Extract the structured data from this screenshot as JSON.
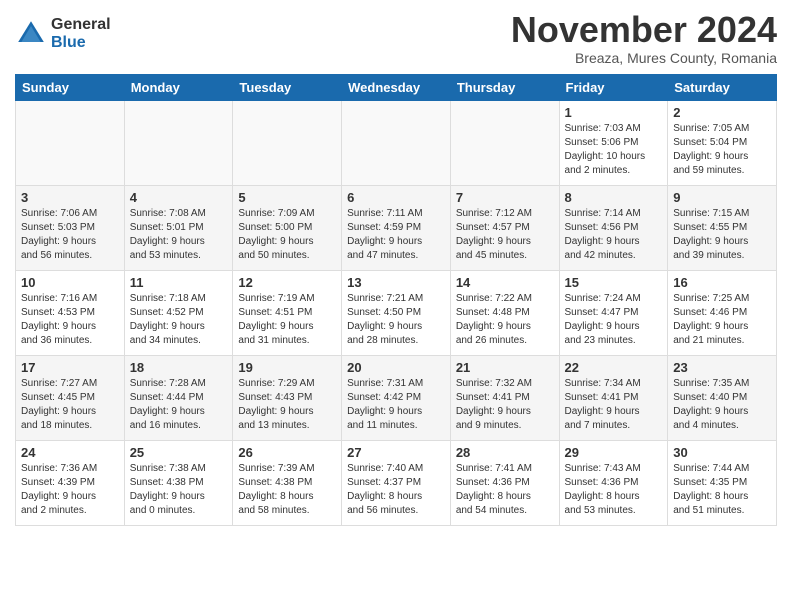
{
  "logo": {
    "general": "General",
    "blue": "Blue"
  },
  "title": "November 2024",
  "subtitle": "Breaza, Mures County, Romania",
  "days_header": [
    "Sunday",
    "Monday",
    "Tuesday",
    "Wednesday",
    "Thursday",
    "Friday",
    "Saturday"
  ],
  "weeks": [
    [
      {
        "day": "",
        "info": ""
      },
      {
        "day": "",
        "info": ""
      },
      {
        "day": "",
        "info": ""
      },
      {
        "day": "",
        "info": ""
      },
      {
        "day": "",
        "info": ""
      },
      {
        "day": "1",
        "info": "Sunrise: 7:03 AM\nSunset: 5:06 PM\nDaylight: 10 hours\nand 2 minutes."
      },
      {
        "day": "2",
        "info": "Sunrise: 7:05 AM\nSunset: 5:04 PM\nDaylight: 9 hours\nand 59 minutes."
      }
    ],
    [
      {
        "day": "3",
        "info": "Sunrise: 7:06 AM\nSunset: 5:03 PM\nDaylight: 9 hours\nand 56 minutes."
      },
      {
        "day": "4",
        "info": "Sunrise: 7:08 AM\nSunset: 5:01 PM\nDaylight: 9 hours\nand 53 minutes."
      },
      {
        "day": "5",
        "info": "Sunrise: 7:09 AM\nSunset: 5:00 PM\nDaylight: 9 hours\nand 50 minutes."
      },
      {
        "day": "6",
        "info": "Sunrise: 7:11 AM\nSunset: 4:59 PM\nDaylight: 9 hours\nand 47 minutes."
      },
      {
        "day": "7",
        "info": "Sunrise: 7:12 AM\nSunset: 4:57 PM\nDaylight: 9 hours\nand 45 minutes."
      },
      {
        "day": "8",
        "info": "Sunrise: 7:14 AM\nSunset: 4:56 PM\nDaylight: 9 hours\nand 42 minutes."
      },
      {
        "day": "9",
        "info": "Sunrise: 7:15 AM\nSunset: 4:55 PM\nDaylight: 9 hours\nand 39 minutes."
      }
    ],
    [
      {
        "day": "10",
        "info": "Sunrise: 7:16 AM\nSunset: 4:53 PM\nDaylight: 9 hours\nand 36 minutes."
      },
      {
        "day": "11",
        "info": "Sunrise: 7:18 AM\nSunset: 4:52 PM\nDaylight: 9 hours\nand 34 minutes."
      },
      {
        "day": "12",
        "info": "Sunrise: 7:19 AM\nSunset: 4:51 PM\nDaylight: 9 hours\nand 31 minutes."
      },
      {
        "day": "13",
        "info": "Sunrise: 7:21 AM\nSunset: 4:50 PM\nDaylight: 9 hours\nand 28 minutes."
      },
      {
        "day": "14",
        "info": "Sunrise: 7:22 AM\nSunset: 4:48 PM\nDaylight: 9 hours\nand 26 minutes."
      },
      {
        "day": "15",
        "info": "Sunrise: 7:24 AM\nSunset: 4:47 PM\nDaylight: 9 hours\nand 23 minutes."
      },
      {
        "day": "16",
        "info": "Sunrise: 7:25 AM\nSunset: 4:46 PM\nDaylight: 9 hours\nand 21 minutes."
      }
    ],
    [
      {
        "day": "17",
        "info": "Sunrise: 7:27 AM\nSunset: 4:45 PM\nDaylight: 9 hours\nand 18 minutes."
      },
      {
        "day": "18",
        "info": "Sunrise: 7:28 AM\nSunset: 4:44 PM\nDaylight: 9 hours\nand 16 minutes."
      },
      {
        "day": "19",
        "info": "Sunrise: 7:29 AM\nSunset: 4:43 PM\nDaylight: 9 hours\nand 13 minutes."
      },
      {
        "day": "20",
        "info": "Sunrise: 7:31 AM\nSunset: 4:42 PM\nDaylight: 9 hours\nand 11 minutes."
      },
      {
        "day": "21",
        "info": "Sunrise: 7:32 AM\nSunset: 4:41 PM\nDaylight: 9 hours\nand 9 minutes."
      },
      {
        "day": "22",
        "info": "Sunrise: 7:34 AM\nSunset: 4:41 PM\nDaylight: 9 hours\nand 7 minutes."
      },
      {
        "day": "23",
        "info": "Sunrise: 7:35 AM\nSunset: 4:40 PM\nDaylight: 9 hours\nand 4 minutes."
      }
    ],
    [
      {
        "day": "24",
        "info": "Sunrise: 7:36 AM\nSunset: 4:39 PM\nDaylight: 9 hours\nand 2 minutes."
      },
      {
        "day": "25",
        "info": "Sunrise: 7:38 AM\nSunset: 4:38 PM\nDaylight: 9 hours\nand 0 minutes."
      },
      {
        "day": "26",
        "info": "Sunrise: 7:39 AM\nSunset: 4:38 PM\nDaylight: 8 hours\nand 58 minutes."
      },
      {
        "day": "27",
        "info": "Sunrise: 7:40 AM\nSunset: 4:37 PM\nDaylight: 8 hours\nand 56 minutes."
      },
      {
        "day": "28",
        "info": "Sunrise: 7:41 AM\nSunset: 4:36 PM\nDaylight: 8 hours\nand 54 minutes."
      },
      {
        "day": "29",
        "info": "Sunrise: 7:43 AM\nSunset: 4:36 PM\nDaylight: 8 hours\nand 53 minutes."
      },
      {
        "day": "30",
        "info": "Sunrise: 7:44 AM\nSunset: 4:35 PM\nDaylight: 8 hours\nand 51 minutes."
      }
    ]
  ]
}
